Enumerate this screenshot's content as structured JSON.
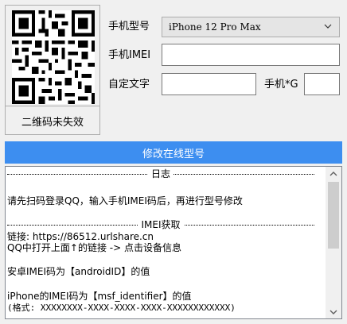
{
  "qr": {
    "status": "二维码未失效"
  },
  "form": {
    "model_label": "手机型号",
    "model_selected": "iPhone 12 Pro Max",
    "imei_label": "手机IMEI",
    "imei_value": "",
    "custom_label": "自定文字",
    "custom_value": "",
    "g_label": "手机*G",
    "g_value": ""
  },
  "actions": {
    "modify_button": "修改在线型号"
  },
  "log": {
    "header": "日志",
    "line1": "请先扫码登录QQ，输入手机IMEI码后，再进行型号修改",
    "imei_header": "IMEI获取",
    "line2": "链接: https://86512.urlshare.cn",
    "line3": "QQ中打开上面↑的链接 -> 点击设备信息",
    "line4": "安卓IMEI码为【androidID】的值",
    "line5": "iPhone的IMEI码为【msf_identifier】的值",
    "line6": "(格式: XXXXXXXX-XXXX-XXXX-XXXX-XXXXXXXXXXXX)"
  },
  "icons": {
    "dropdown": "chevron-down-icon",
    "scroll_up": "arrow-up-icon",
    "scroll_down": "arrow-down-icon"
  }
}
